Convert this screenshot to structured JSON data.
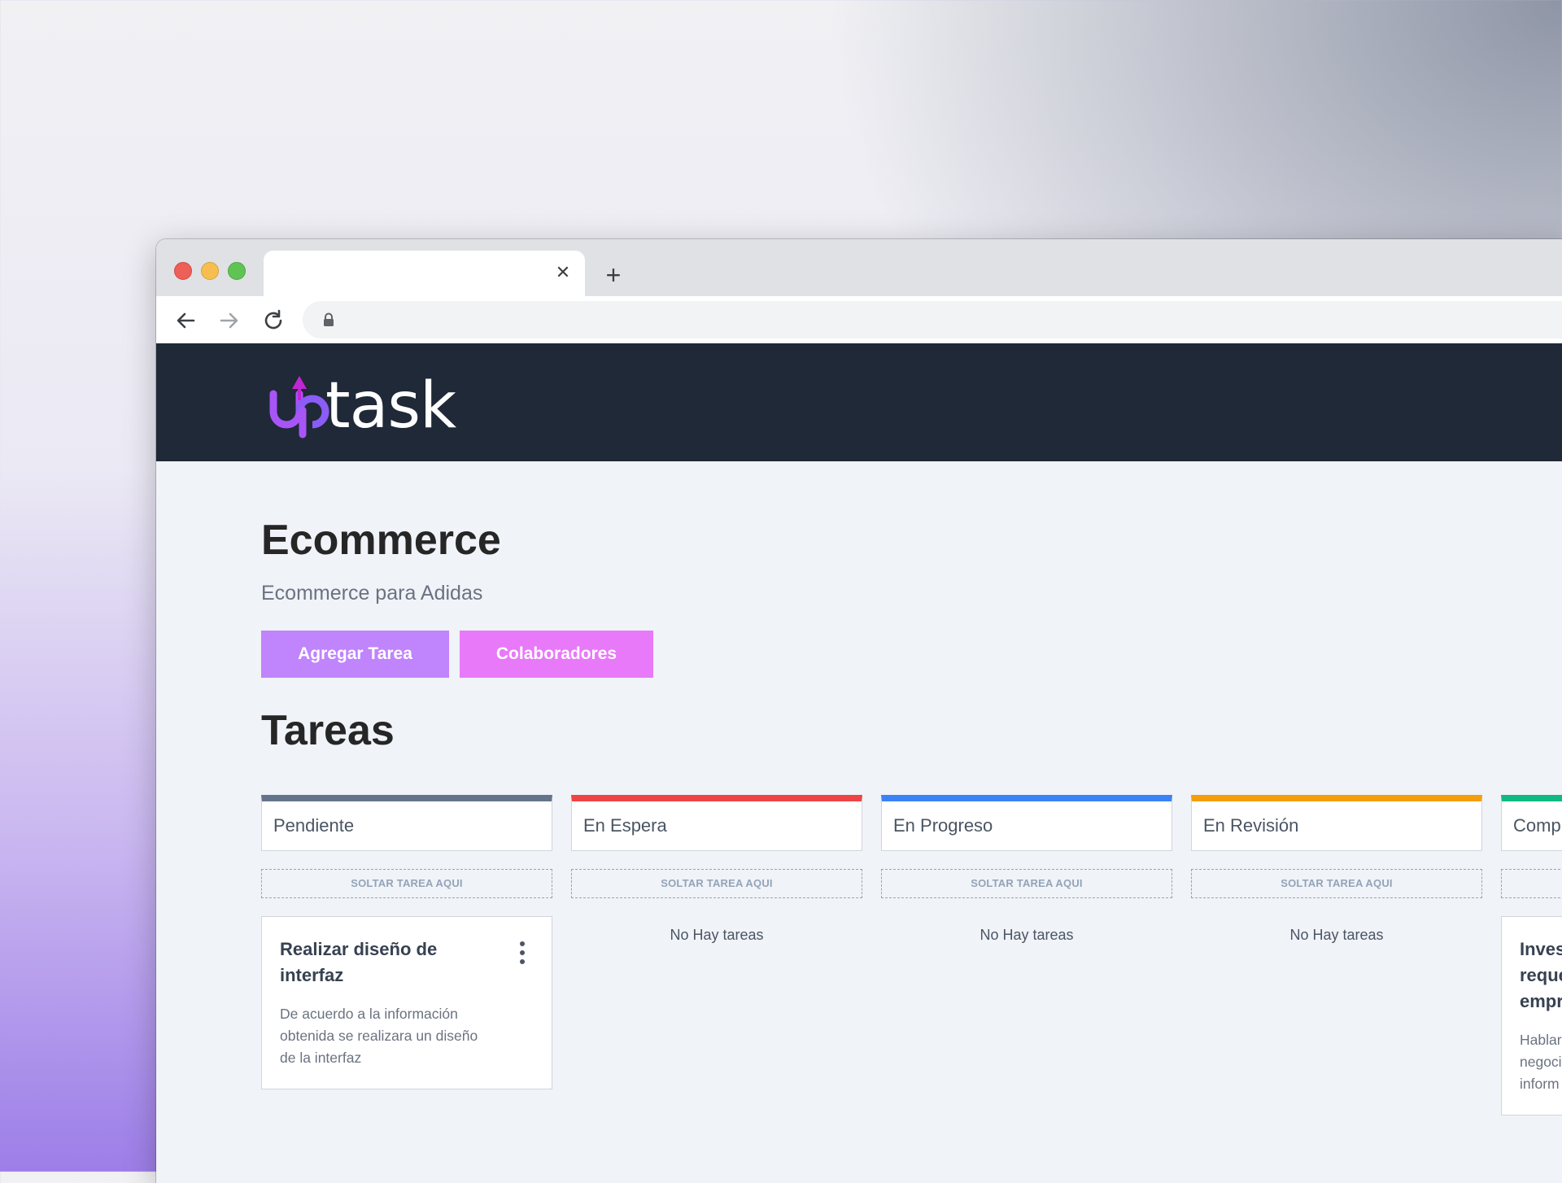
{
  "browser": {
    "tab": {
      "title": "",
      "close_icon": "close-icon"
    },
    "new_tab_label": "+",
    "address": {
      "url": ""
    }
  },
  "app": {
    "logo": {
      "text": "task",
      "mark_letter": "u",
      "accent": "#a855f7"
    },
    "header_bg": "#1f2937"
  },
  "project": {
    "title": "Ecommerce",
    "description": "Ecommerce para Adidas",
    "add_task_label": "Agregar Tarea",
    "collaborators_label": "Colaboradores"
  },
  "tasks": {
    "title": "Tareas",
    "columns": [
      {
        "name": "Pendiente",
        "color": "#64748b",
        "drop_label": "SOLTAR TAREA AQUI",
        "empty_label": "",
        "cards": [
          {
            "title": "Realizar diseño de interfaz",
            "description": "De acuerdo a la información obtenida se realizara un diseño de la interfaz"
          }
        ]
      },
      {
        "name": "En Espera",
        "color": "#ef4444",
        "drop_label": "SOLTAR TAREA AQUI",
        "empty_label": "No Hay tareas",
        "cards": []
      },
      {
        "name": "En Progreso",
        "color": "#3b82f6",
        "drop_label": "SOLTAR TAREA AQUI",
        "empty_label": "No Hay tareas",
        "cards": []
      },
      {
        "name": "En Revisión",
        "color": "#f59e0b",
        "drop_label": "SOLTAR TAREA AQUI",
        "empty_label": "No Hay tareas",
        "cards": []
      },
      {
        "name": "Comp",
        "color": "#10b981",
        "drop_label": "",
        "empty_label": "",
        "cards": [
          {
            "title": "Inves reque empr",
            "description": "Hablar negoci inform"
          }
        ]
      }
    ]
  }
}
